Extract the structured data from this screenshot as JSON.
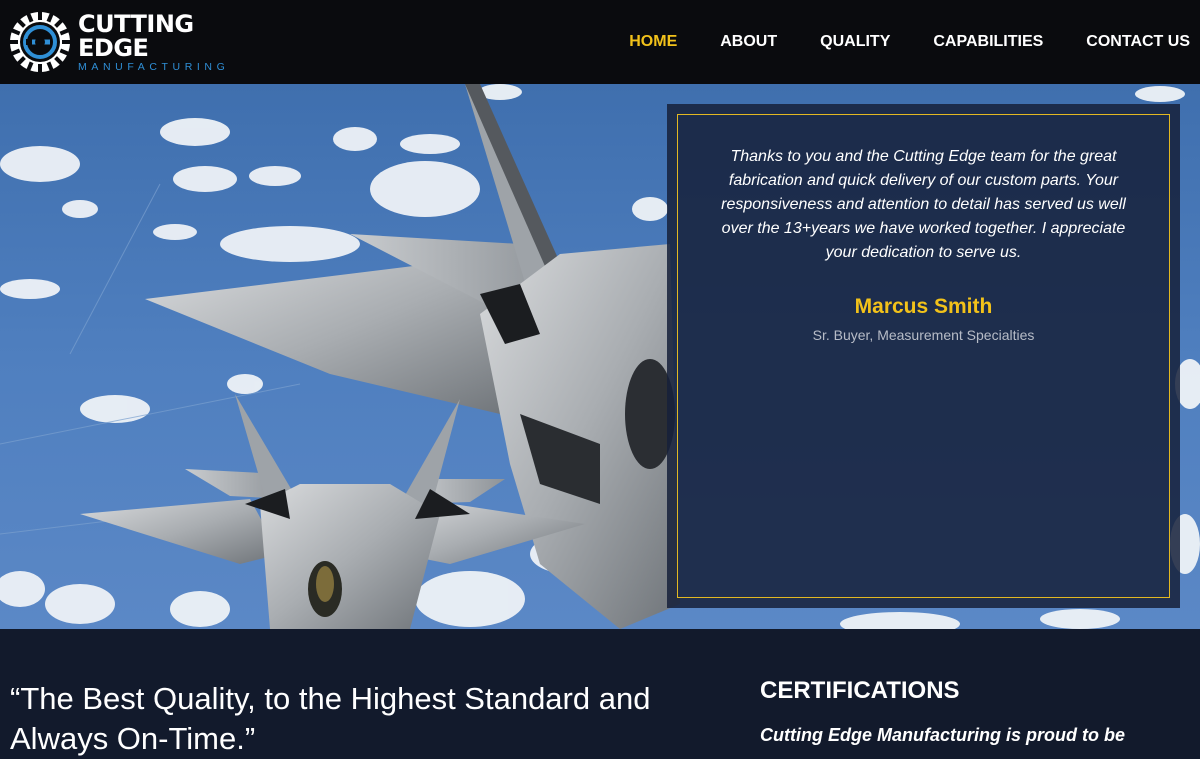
{
  "brand": {
    "name": "CUTTING EDGE",
    "subtitle": "MANUFACTURING"
  },
  "nav": {
    "items": [
      {
        "label": "HOME",
        "active": true
      },
      {
        "label": "ABOUT",
        "active": false
      },
      {
        "label": "QUALITY",
        "active": false
      },
      {
        "label": "CAPABILITIES",
        "active": false
      },
      {
        "label": "CONTACT US",
        "active": false
      }
    ]
  },
  "testimonial": {
    "quote": "Thanks to you and the Cutting Edge team for the great fabrication and quick delivery of our custom parts. Your responsiveness and attention to detail has served us well over the 13+years we have worked together. I appreciate your dedication to serve us.",
    "name": "Marcus Smith",
    "title": "Sr. Buyer, Measurement Specialties"
  },
  "tagline": "“The Best Quality, to the Highest Standard and Always On-Time.”",
  "certifications": {
    "heading": "CERTIFICATIONS",
    "intro": "Cutting Edge Manufacturing is proud to be"
  },
  "colors": {
    "accent": "#f2c21a",
    "header_bg": "#0a0b0e",
    "panel_bg": "#16213a",
    "page_bg": "#121a2c",
    "logo_blue": "#2f8fd6"
  }
}
